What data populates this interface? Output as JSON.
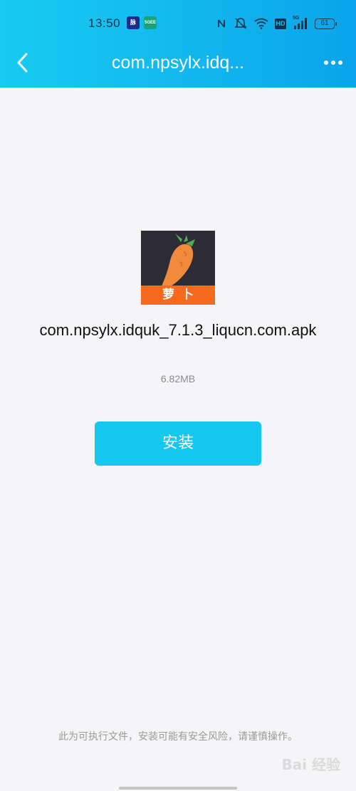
{
  "status_bar": {
    "time": "13:50",
    "notif1": "脉",
    "notif2": "5GEE",
    "network": "5G",
    "hd": "HD",
    "battery": "61"
  },
  "header": {
    "title": "com.npsylx.idq...",
    "back_icon": "chevron-left-icon",
    "more_icon": "more-dots-icon"
  },
  "app": {
    "icon_label": "萝卜",
    "file_name": "com.npsylx.idquk_7.1.3_liqucn.com.apk",
    "file_size": "6.82MB"
  },
  "actions": {
    "install_label": "安装"
  },
  "footer": {
    "warning": "此为可执行文件，安装可能有安全风险，请谨慎操作。",
    "watermark": "Bai 经验"
  },
  "colors": {
    "header_start": "#18cbf2",
    "header_end": "#0aa4ea",
    "install_button": "#14c8f2",
    "app_icon_bg": "#2c2b36",
    "app_icon_banner": "#f56a1c"
  }
}
